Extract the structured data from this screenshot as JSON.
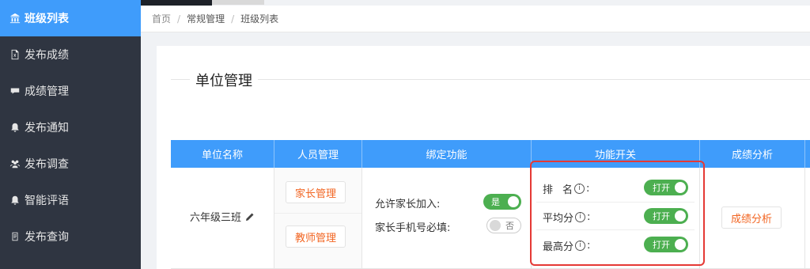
{
  "sidebar": {
    "items": [
      {
        "label": "班级列表",
        "icon": "bank-icon",
        "active": true
      },
      {
        "label": "发布成绩",
        "icon": "excel-icon"
      },
      {
        "label": "成绩管理",
        "icon": "comment-icon"
      },
      {
        "label": "发布通知",
        "icon": "bell-icon"
      },
      {
        "label": "发布调查",
        "icon": "users-icon"
      },
      {
        "label": "智能评语",
        "icon": "bell-icon"
      },
      {
        "label": "发布查询",
        "icon": "clipboard-icon"
      }
    ]
  },
  "breadcrumb": [
    "首页",
    "常规管理",
    "班级列表"
  ],
  "card": {
    "title": "单位管理"
  },
  "table": {
    "headers": [
      "单位名称",
      "人员管理",
      "绑定功能",
      "功能开关",
      "成绩分析"
    ],
    "row": {
      "unit_name": "六年级三班",
      "people_buttons": [
        "家长管理",
        "教师管理"
      ],
      "bind": [
        {
          "label": "允许家长加入:",
          "switch_text": "是",
          "on": true
        },
        {
          "label": "家长手机号必填:",
          "switch_text": "否",
          "on": false
        }
      ],
      "toggles": [
        {
          "label_a": "排",
          "label_b": "名",
          "suffix": ":",
          "switch_text": "打开"
        },
        {
          "label_a": "平均分",
          "label_b": "",
          "suffix": ":",
          "switch_text": "打开"
        },
        {
          "label_a": "最高分",
          "label_b": "",
          "suffix": ":",
          "switch_text": "打开"
        }
      ],
      "analysis_button": "成绩分析"
    }
  },
  "colors": {
    "sidebar_bg": "#2f3541",
    "accent": "#3f9cfb",
    "switch_on": "#4caf50",
    "orange": "#f26522",
    "highlight": "#e53935"
  }
}
